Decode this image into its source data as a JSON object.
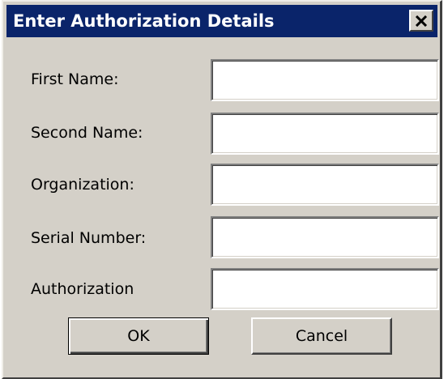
{
  "window": {
    "title": "Enter Authorization Details",
    "close_icon": "close-icon",
    "titlebar_color": "#0a246a",
    "background_color": "#d4d0c8"
  },
  "form": {
    "fields": [
      {
        "label": "First Name:",
        "value": ""
      },
      {
        "label": "Second Name:",
        "value": ""
      },
      {
        "label": "Organization:",
        "value": ""
      },
      {
        "label": "Serial Number:",
        "value": ""
      },
      {
        "label": "Authorization",
        "value": ""
      }
    ]
  },
  "buttons": {
    "ok_label": "OK",
    "cancel_label": "Cancel"
  }
}
